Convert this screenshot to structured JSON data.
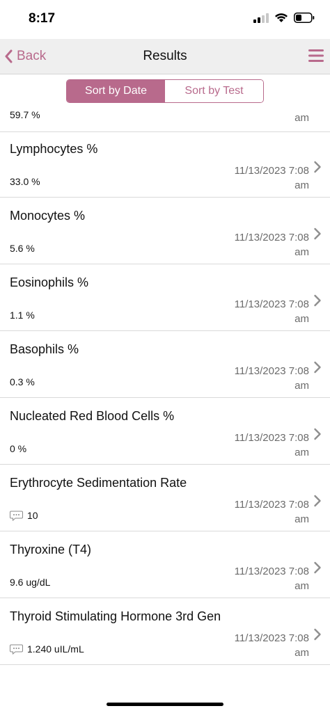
{
  "status_bar": {
    "time": "8:17"
  },
  "nav": {
    "back_label": "Back",
    "title": "Results"
  },
  "sort": {
    "by_date": "Sort by Date",
    "by_test": "Sort by Test"
  },
  "partial_row": {
    "value": "59.7 %",
    "date_tail": "am"
  },
  "results": [
    {
      "name": "Lymphocytes %",
      "value": "33.0 %",
      "date": "11/13/2023 7:08",
      "ampm": "am",
      "has_comment": false
    },
    {
      "name": "Monocytes %",
      "value": "5.6 %",
      "date": "11/13/2023 7:08",
      "ampm": "am",
      "has_comment": false
    },
    {
      "name": "Eosinophils %",
      "value": "1.1 %",
      "date": "11/13/2023 7:08",
      "ampm": "am",
      "has_comment": false
    },
    {
      "name": "Basophils %",
      "value": "0.3 %",
      "date": "11/13/2023 7:08",
      "ampm": "am",
      "has_comment": false
    },
    {
      "name": "Nucleated Red Blood Cells %",
      "value": "0 %",
      "date": "11/13/2023 7:08",
      "ampm": "am",
      "has_comment": false
    },
    {
      "name": "Erythrocyte Sedimentation Rate",
      "value": "10",
      "date": "11/13/2023 7:08",
      "ampm": "am",
      "has_comment": true
    },
    {
      "name": "Thyroxine (T4)",
      "value": "9.6 ug/dL",
      "date": "11/13/2023 7:08",
      "ampm": "am",
      "has_comment": false
    },
    {
      "name": "Thyroid Stimulating Hormone 3rd Gen",
      "value": "1.240 uIL/mL",
      "date": "11/13/2023 7:08",
      "ampm": "am",
      "has_comment": true
    }
  ],
  "colors": {
    "accent": "#b86a8c",
    "nav_bg": "#efefef",
    "divider": "#d9d9d9",
    "date_text": "#6b6b6b"
  },
  "icons": {
    "back": "chevron-left-icon",
    "menu": "hamburger-menu-icon",
    "row": "chevron-right-icon",
    "comment": "comment-bubble-icon"
  }
}
